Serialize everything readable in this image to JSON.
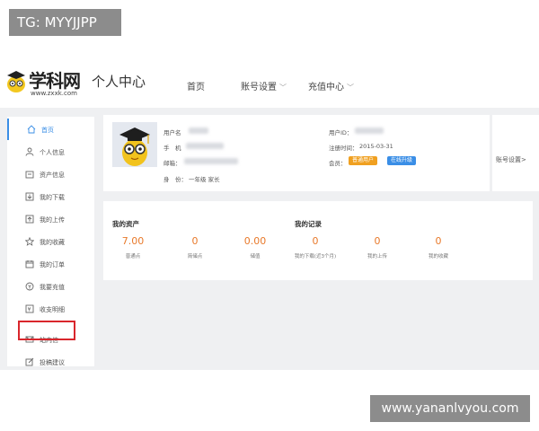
{
  "watermarks": {
    "top_left": "TG: MYYJJPP",
    "bottom_right": "www.yananlvyou.com"
  },
  "header": {
    "logo_text": "学科网",
    "logo_url": "www.zxxk.com",
    "title": "个人中心",
    "nav": [
      {
        "label": "首页",
        "has_dropdown": false
      },
      {
        "label": "账号设置",
        "has_dropdown": true
      },
      {
        "label": "充值中心",
        "has_dropdown": true
      }
    ]
  },
  "sidebar": {
    "items": [
      {
        "label": "首页",
        "icon": "home-icon",
        "active": true
      },
      {
        "label": "个人信息",
        "icon": "user-icon",
        "active": false
      },
      {
        "label": "资产信息",
        "icon": "wallet-icon",
        "active": false
      },
      {
        "label": "我的下载",
        "icon": "download-icon",
        "active": false
      },
      {
        "label": "我的上传",
        "icon": "upload-icon",
        "active": false
      },
      {
        "label": "我的收藏",
        "icon": "star-icon",
        "active": false
      },
      {
        "label": "我的订单",
        "icon": "order-icon",
        "active": false
      },
      {
        "label": "我要充值",
        "icon": "recharge-icon",
        "active": false
      },
      {
        "label": "收支明细",
        "icon": "ledger-icon",
        "active": false
      },
      {
        "label": "站内信",
        "icon": "mail-icon",
        "active": false
      },
      {
        "label": "投稿建议",
        "icon": "edit-icon",
        "active": false
      }
    ]
  },
  "profile": {
    "username_label": "用户名",
    "phone_label": "手　机",
    "email_label": "邮箱：",
    "identity_label": "身　份：",
    "identity_value": "一年级 家长",
    "userid_label": "用户ID：",
    "register_label": "注册时间：",
    "register_value": "2015-03-31",
    "member_label": "会员：",
    "badge_normal": "普通用户",
    "badge_upgrade": "在线升级",
    "account_settings": "账号设置>"
  },
  "assets": {
    "title": "我的资产",
    "items": [
      {
        "value": "7.00",
        "label": "普通点"
      },
      {
        "value": "0",
        "label": "简储点"
      },
      {
        "value": "0.00",
        "label": "储值"
      }
    ]
  },
  "records": {
    "title": "我的记录",
    "items": [
      {
        "value": "0",
        "label": "我的下载(近3个月)"
      },
      {
        "value": "0",
        "label": "我的上传"
      },
      {
        "value": "0",
        "label": "我的收藏"
      }
    ]
  },
  "colors": {
    "accent": "#3a8ee6",
    "orange": "#e8792a",
    "highlight": "#d9262c",
    "badge_orange": "#f0a020",
    "badge_blue": "#3a8ee6"
  }
}
